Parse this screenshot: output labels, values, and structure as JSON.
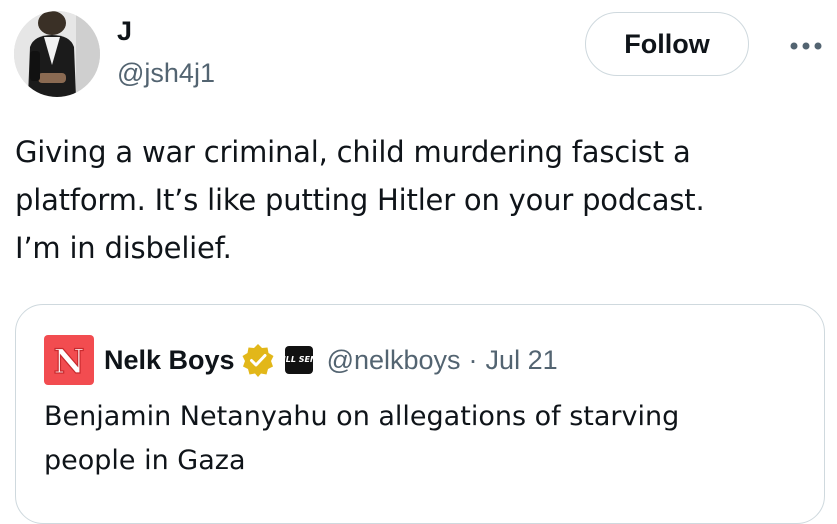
{
  "author": {
    "display_name": "J",
    "handle": "@jsh4j1",
    "avatar_icon": "profile-photo"
  },
  "actions": {
    "follow_label": "Follow",
    "more_icon": "more-horizontal-icon"
  },
  "tweet": {
    "lines": [
      "Giving a war criminal, child murdering fascist a",
      "platform. It’s like putting Hitler on your podcast.",
      "I’m in disbelief."
    ]
  },
  "quote": {
    "avatar_letter": "N",
    "display_name": "Nelk Boys",
    "verified_icon": "gold-verified-badge",
    "affiliate_badge": "FULL SEND",
    "handle": "@nelkboys",
    "separator": "·",
    "date": "Jul 21",
    "lines": [
      "Benjamin Netanyahu on allegations of starving",
      "people in Gaza"
    ]
  },
  "colors": {
    "text_primary": "#0f1419",
    "text_secondary": "#536471",
    "border": "#cfd9de",
    "verified_gold": "#e2b719",
    "nelk_red": "#f24c50"
  }
}
